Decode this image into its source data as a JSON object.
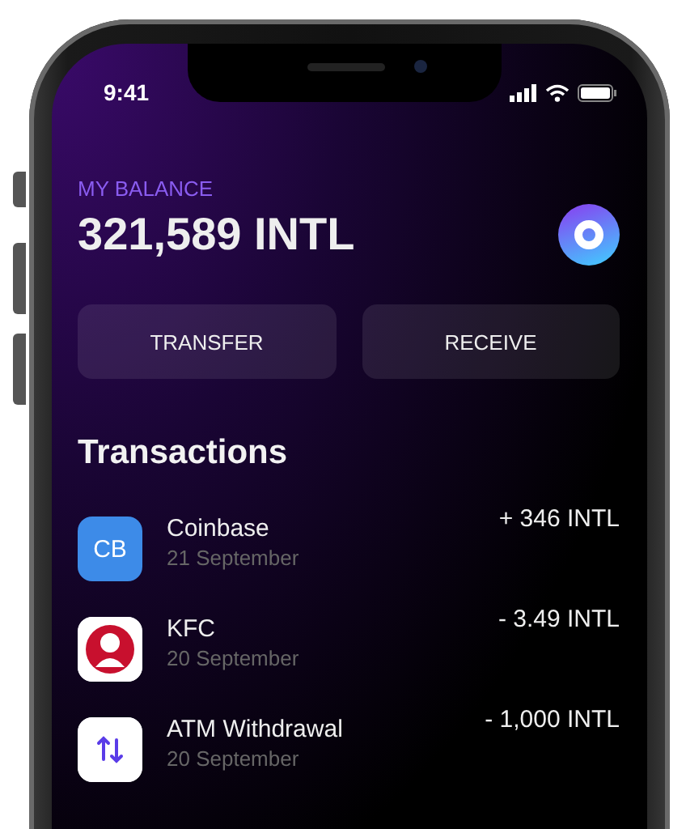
{
  "status_bar": {
    "time": "9:41"
  },
  "balance": {
    "label": "MY BALANCE",
    "amount": "321,589 INTL"
  },
  "actions": [
    "TRANSFER",
    "RECEIVE"
  ],
  "transactions_title": "Transactions",
  "transactions": [
    {
      "kind": "text-logo",
      "logo_text": "CB",
      "name": "Coinbase",
      "date": "21 September",
      "amount": "+ 346 INTL"
    },
    {
      "kind": "image-logo",
      "name": "KFC",
      "date": "20 September",
      "amount": "- 3.49 INTL"
    },
    {
      "kind": "transfer",
      "name": "ATM Withdrawal",
      "date": "20 September",
      "amount": "- 1,000 INTL"
    }
  ]
}
